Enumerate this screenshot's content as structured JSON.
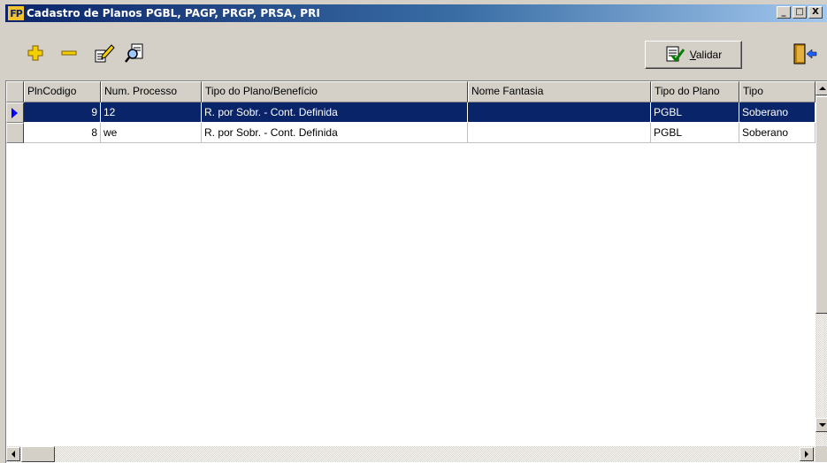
{
  "window": {
    "title": "Cadastro de Planos PGBL, PAGP, PRGP, PRSA, PRI",
    "logo_text": "FP",
    "controls": {
      "minimize": "_",
      "maximize": "□",
      "close": "X"
    }
  },
  "toolbar": {
    "icons": [
      "plus-icon",
      "minus-icon",
      "edit-icon",
      "find-icon",
      "exit-icon"
    ],
    "validar_label": "Validar",
    "validar_accesskey": "V",
    "validar_rest": "alidar"
  },
  "grid": {
    "columns": [
      "PlnCodigo",
      "Num. Processo",
      "Tipo do Plano/Benefício",
      "Nome Fantasia",
      "Tipo do Plano",
      "Tipo"
    ],
    "rows": [
      {
        "plncodigo": "9",
        "num_processo": "12",
        "tipo_plano_beneficio": "R. por Sobr. - Cont. Definida",
        "nome_fantasia": "",
        "tipo_do_plano": "PGBL",
        "tipo": "Soberano",
        "selected": true
      },
      {
        "plncodigo": "8",
        "num_processo": "we",
        "tipo_plano_beneficio": "R. por Sobr. - Cont. Definida",
        "nome_fantasia": "",
        "tipo_do_plano": "PGBL",
        "tipo": "Soberano",
        "selected": false
      }
    ]
  },
  "colors": {
    "selection": "#0a246a",
    "title_bar": "#0a246a",
    "face": "#d4d0c8",
    "plus_icon": "#f0c000",
    "minus_icon": "#f0c000"
  }
}
